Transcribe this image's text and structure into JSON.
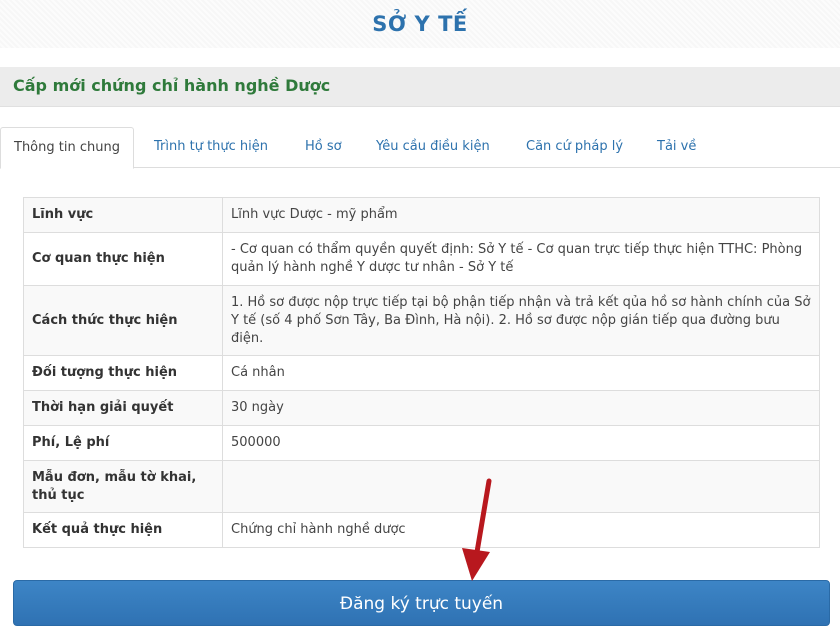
{
  "header": {
    "title": "SỞ Y TẾ"
  },
  "procedure": {
    "title": "Cấp mới chứng chỉ hành nghề Dược"
  },
  "tabs": [
    {
      "label": "Thông tin chung",
      "active": true
    },
    {
      "label": "Trình tự thực hiện",
      "active": false
    },
    {
      "label": "Hồ sơ",
      "active": false
    },
    {
      "label": "Yêu cầu điều kiện",
      "active": false
    },
    {
      "label": "Căn cứ pháp lý",
      "active": false
    },
    {
      "label": "Tải về",
      "active": false
    }
  ],
  "info_rows": [
    {
      "label": "Lĩnh vực",
      "value": "Lĩnh vực Dược - mỹ phẩm"
    },
    {
      "label": "Cơ quan thực hiện",
      "value": "- Cơ quan có thẩm quyền quyết định: Sở Y tế - Cơ quan trực tiếp thực hiện TTHC: Phòng quản lý hành nghề Y dược tư nhân - Sở Y tế"
    },
    {
      "label": "Cách thức thực hiện",
      "value": "1. Hồ sơ được nộp trực tiếp tại bộ phận tiếp nhận và trả kết qủa hồ sơ hành chính của Sở Y tế (số 4 phố Sơn Tây, Ba Đình, Hà nội). 2. Hồ sơ được nộp gián tiếp qua đường bưu điện."
    },
    {
      "label": "Đối tượng thực hiện",
      "value": "Cá nhân"
    },
    {
      "label": "Thời hạn giải quyết",
      "value": "30 ngày"
    },
    {
      "label": "Phí, Lệ phí",
      "value": "500000"
    },
    {
      "label": "Mẫu đơn, mẫu tờ khai, thủ tục",
      "value": ""
    },
    {
      "label": "Kết quả thực hiện",
      "value": "Chứng chỉ hành nghề dược"
    }
  ],
  "register_button": {
    "label": "Đăng ký trực tuyến"
  },
  "colors": {
    "brand": "#2d72ad",
    "procedure_title": "#2f7a3b",
    "button": "#3479bd",
    "arrow": "#b8181e"
  }
}
